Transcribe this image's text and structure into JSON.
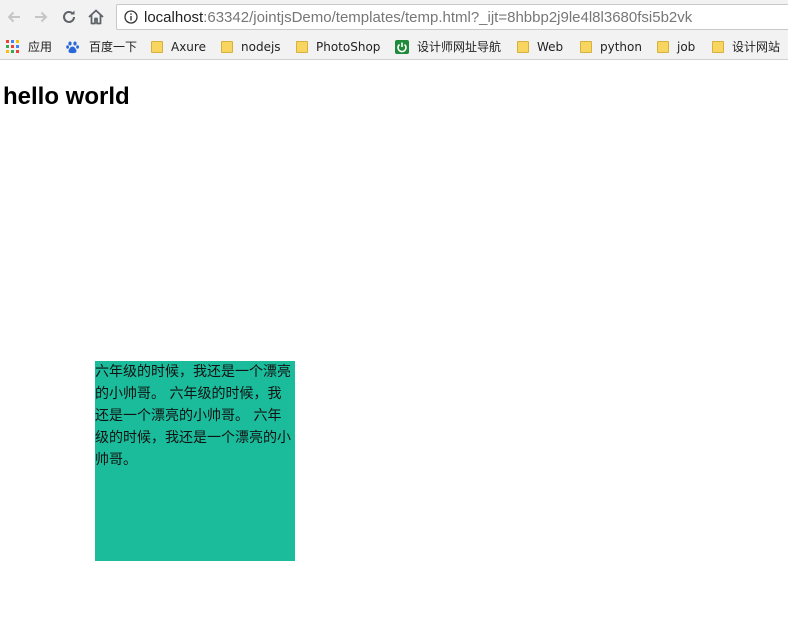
{
  "browser": {
    "url": {
      "host": "localhost",
      "rest": ":63342/jointjsDemo/templates/temp.html?_ijt=8hbbp2j9le4l8l3680fsi5b2vk"
    },
    "bookmarks": [
      {
        "label": "应用",
        "icon": "apps-grid-icon"
      },
      {
        "label": "百度一下",
        "icon": "baidu-paw-icon"
      },
      {
        "label": "Axure",
        "icon": "folder-icon"
      },
      {
        "label": "nodejs",
        "icon": "folder-icon"
      },
      {
        "label": "PhotoShop",
        "icon": "folder-icon"
      },
      {
        "label": "设计师网址导航",
        "icon": "green-power-icon"
      },
      {
        "label": "Web",
        "icon": "folder-icon"
      },
      {
        "label": "python",
        "icon": "folder-icon"
      },
      {
        "label": "job",
        "icon": "folder-icon"
      },
      {
        "label": "设计网站",
        "icon": "folder-icon"
      }
    ]
  },
  "page": {
    "title": "hello world",
    "box_text": "六年级的时候，我还是一个漂亮的小帅哥。 六年级的时候，我还是一个漂亮的小帅哥。 六年级的时候，我还是一个漂亮的小帅哥。",
    "box_color": "#1abc9c"
  }
}
